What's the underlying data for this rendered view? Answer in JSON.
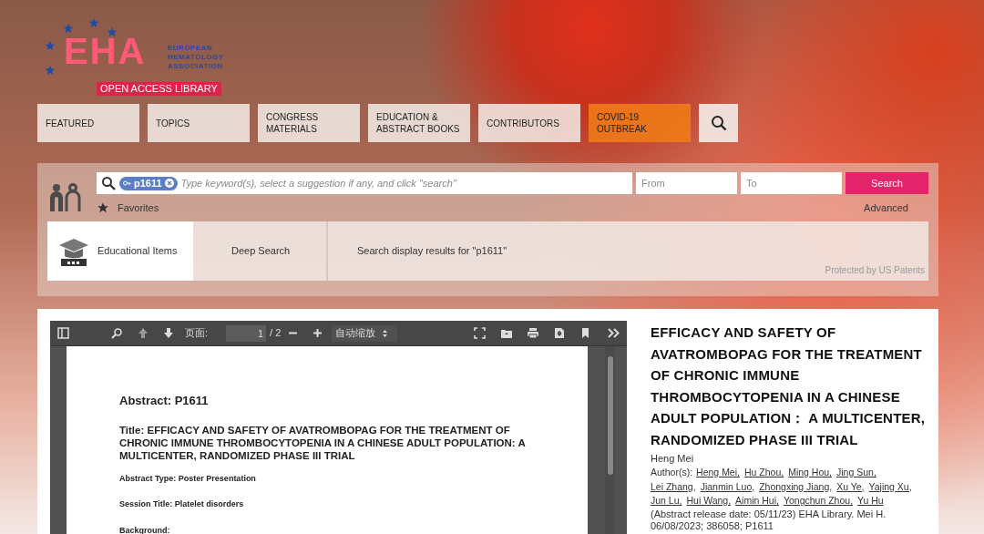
{
  "logo": {
    "mark": "EHA",
    "org": [
      "EUROPEAN",
      "HEMATOLOGY",
      "ASSOCIATION"
    ],
    "banner": "OPEN ACCESS LIBRARY"
  },
  "nav": [
    {
      "label": "FEATURED",
      "highlighted": false
    },
    {
      "label": "TOPICS",
      "highlighted": false
    },
    {
      "label": "CONGRESS MATERIALS",
      "highlighted": false
    },
    {
      "label": "EDUCATION & ABSTRACT BOOKS",
      "highlighted": false
    },
    {
      "label": "CONTRIBUTORS",
      "highlighted": false
    },
    {
      "label": "COVID-19 OUTBREAK",
      "highlighted": true
    }
  ],
  "search": {
    "tag": "p1611",
    "placeholder": "Type keyword(s), select a suggestion if any, and click \"search\"",
    "from_placeholder": "From",
    "to_placeholder": "To",
    "button": "Search",
    "favorites": "Favorites",
    "advanced": "Advanced"
  },
  "tabs": [
    {
      "label": "Educational Items",
      "selected": true
    },
    {
      "label": "Deep Search",
      "selected": false
    }
  ],
  "results_text": "Search display results for \"p1611\"",
  "patents": "Protected by US Patents",
  "viewer": {
    "page_label": "页面:",
    "page": "1",
    "page_total": "/ 2",
    "zoom": "自动缩放",
    "document": [
      {
        "kind": "heading",
        "text": "Abstract: P1611"
      },
      {
        "kind": "title",
        "text": "Title: EFFICACY AND SAFETY OF AVATROMBOPAG FOR THE TREATMENT OF CHRONIC IMMUNE THROMBOCYTOPENIA IN A CHINESE ADULT POPULATION: A MULTICENTER, RANDOMIZED PHASE III TRIAL"
      },
      {
        "kind": "field",
        "text": "Abstract Type: Poster Presentation"
      },
      {
        "kind": "field",
        "text": "Session Title: Platelet disorders"
      },
      {
        "kind": "field",
        "text": "Background:"
      }
    ]
  },
  "details": {
    "title": "EFFICACY AND SAFETY OF AVATROMBOPAG FOR THE TREATMENT OF CHRONIC IMMUNE THROMBOCYTOPENIA IN A CHINESE ADULT POPULATION： A MULTICENTER, RANDOMIZED PHASE III TRIAL",
    "presenter": "Heng Mei",
    "authors_label": "Author(s):",
    "authors": [
      "Heng Mei,",
      "Hu Zhou,",
      "Ming Hou,",
      "Jing Sun,",
      "Lei Zhang,",
      "Jianmin Luo,",
      "Zhongxing Jiang,",
      "Xu Ye,",
      "Yajing Xu,",
      "Jun Lu,",
      "Hui Wang,",
      "Aimin Hui,",
      "Yongchun Zhou,",
      "Yu Hu"
    ],
    "citation": "(Abstract release date: 05/11/23) EHA Library. Mei H. 06/08/2023; 386058; P1611"
  }
}
